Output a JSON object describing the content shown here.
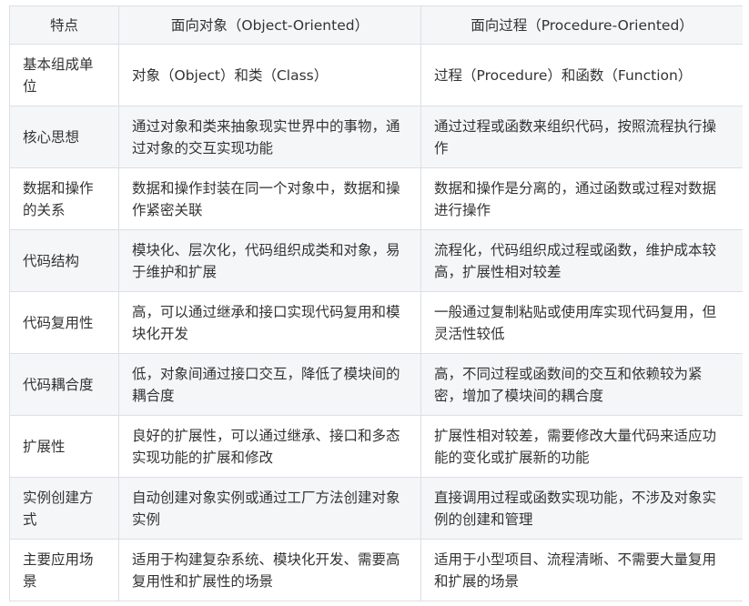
{
  "table": {
    "headers": [
      "特点",
      "面向对象（Object-Oriented）",
      "面向过程（Procedure-Oriented）"
    ],
    "rows": [
      [
        "基本组成单位",
        "对象（Object）和类（Class）",
        "过程（Procedure）和函数（Function）"
      ],
      [
        "核心思想",
        "通过对象和类来抽象现实世界中的事物，通过对象的交互实现功能",
        "通过过程或函数来组织代码，按照流程执行操作"
      ],
      [
        "数据和操作的关系",
        "数据和操作封装在同一个对象中，数据和操作紧密关联",
        "数据和操作是分离的，通过函数或过程对数据进行操作"
      ],
      [
        "代码结构",
        "模块化、层次化，代码组织成类和对象，易于维护和扩展",
        "流程化，代码组织成过程或函数，维护成本较高，扩展性相对较差"
      ],
      [
        "代码复用性",
        "高，可以通过继承和接口实现代码复用和模块化开发",
        "一般通过复制粘贴或使用库实现代码复用，但灵活性较低"
      ],
      [
        "代码耦合度",
        "低，对象间通过接口交互，降低了模块间的耦合度",
        "高，不同过程或函数间的交互和依赖较为紧密，增加了模块间的耦合度"
      ],
      [
        "扩展性",
        "良好的扩展性，可以通过继承、接口和多态实现功能的扩展和修改",
        "扩展性相对较差，需要修改大量代码来适应功能的变化或扩展新的功能"
      ],
      [
        "实例创建方式",
        "自动创建对象实例或通过工厂方法创建对象实例",
        "直接调用过程或函数实现功能，不涉及对象实例的创建和管理"
      ],
      [
        "主要应用场景",
        "适用于构建复杂系统、模块化开发、需要高复用性和扩展性的场景",
        "适用于小型项目、流程清晰、不需要大量复用和扩展的场景"
      ]
    ]
  }
}
